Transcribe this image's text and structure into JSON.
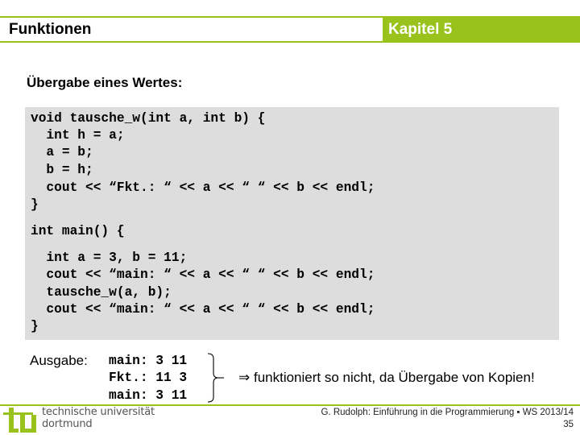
{
  "header": {
    "title": "Funktionen",
    "chapter": "Kapitel 5",
    "accent_color": "#99c31c"
  },
  "section": {
    "heading": "Übergabe eines Wertes:"
  },
  "code": {
    "lines": [
      "void tausche_w(int a, int b) {",
      "  int h = a;",
      "  a = b;",
      "  b = h;",
      "  cout << “Fkt.: “ << a << “ “ << b << endl;",
      "}",
      "int main() {",
      "  int a = 3, b = 11;",
      "  cout << “main: “ << a << “ “ << b << endl;",
      "  tausche_w(a, b);",
      "  cout << “main: “ << a << “ “ << b << endl;",
      "}"
    ]
  },
  "output": {
    "label": "Ausgabe:",
    "lines": [
      "main: 3 11",
      "Fkt.: 11 3",
      "main: 3 11"
    ],
    "conclusion": "⇒ funktioniert so nicht, da Übergabe von Kopien!"
  },
  "footer": {
    "logo": "tu-logo-icon",
    "university_line1": "technische universität",
    "university_line2": "dortmund",
    "course": "G. Rudolph: Einführung in die Programmierung ▪ WS 2013/14",
    "page": "35"
  }
}
